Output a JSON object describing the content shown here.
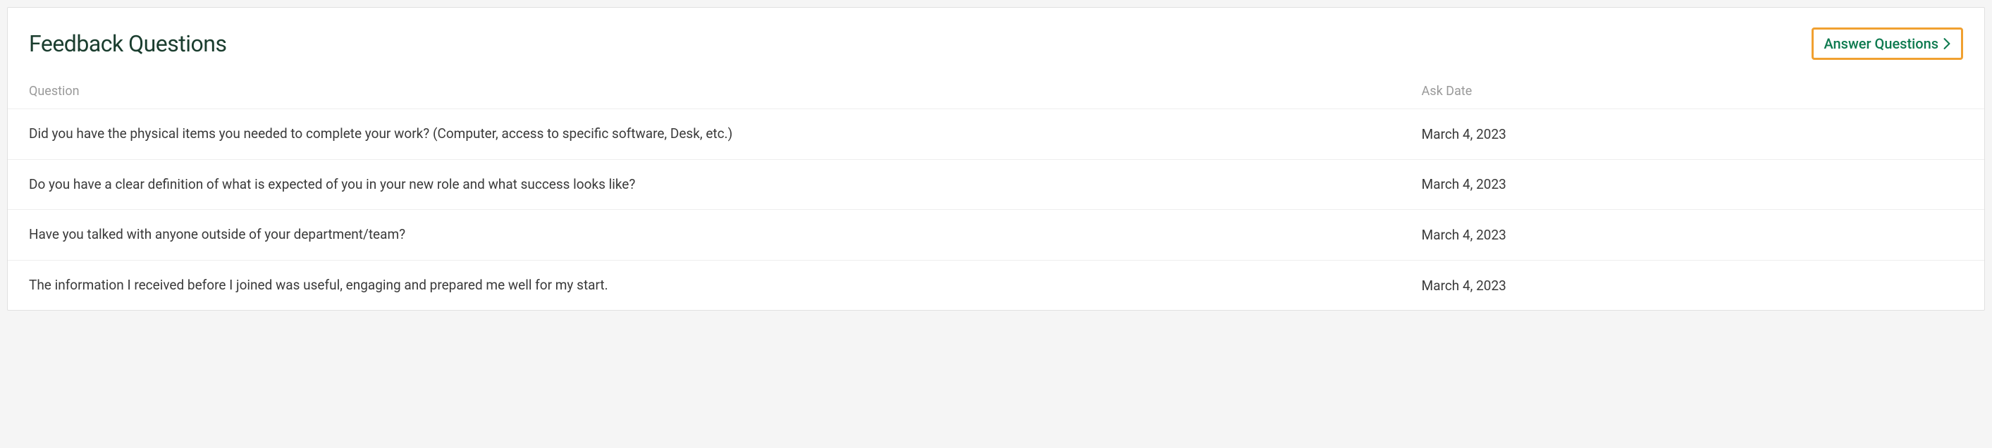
{
  "header": {
    "title": "Feedback Questions",
    "answer_button": "Answer Questions"
  },
  "columns": {
    "question": "Question",
    "ask_date": "Ask Date"
  },
  "rows": [
    {
      "question": "Did you have the physical items you needed to complete your work? (Computer, access to specific software, Desk, etc.)",
      "ask_date": "March 4, 2023"
    },
    {
      "question": "Do you have a clear definition of what is expected of you in your new role and what success looks like?",
      "ask_date": "March 4, 2023"
    },
    {
      "question": "Have you talked with anyone outside of your department/team?",
      "ask_date": "March 4, 2023"
    },
    {
      "question": "The information I received before I joined was useful, engaging and prepared me well for my start.",
      "ask_date": "March 4, 2023"
    }
  ]
}
